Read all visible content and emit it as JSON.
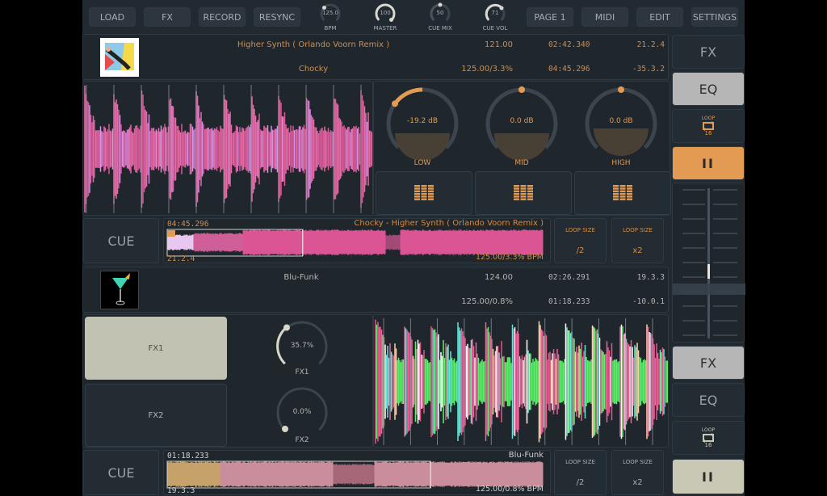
{
  "toolbar": {
    "buttons": [
      {
        "label": "LOAD"
      },
      {
        "label": "FX"
      },
      {
        "label": "RECORD"
      },
      {
        "label": "RESYNC"
      },
      {
        "label": "PAGE 1"
      },
      {
        "label": "MIDI"
      },
      {
        "label": "EDIT"
      },
      {
        "label": "SETTINGS"
      }
    ],
    "knobs": [
      {
        "label": "BPM",
        "value": "125.0"
      },
      {
        "label": "MASTER",
        "value": "100"
      },
      {
        "label": "CUE MIX",
        "value": "50"
      },
      {
        "label": "CUE VOL",
        "value": "71"
      }
    ]
  },
  "deck_a": {
    "title": "Higher Synth ( Orlando Voorn Remix )",
    "artist": "Chocky",
    "bpm_original": "121.00",
    "bpm_pitch": "125.00/3.3%",
    "elapsed": "02:42.340",
    "remaining": "04:45.296",
    "beat_pos": "21.2.4",
    "beat_remaining": "-35.3.2",
    "eq": [
      {
        "label": "LOW",
        "value": "-19.2 dB"
      },
      {
        "label": "MID",
        "value": "0.0 dB"
      },
      {
        "label": "HIGH",
        "value": "0.0 dB"
      }
    ],
    "cue_label": "CUE",
    "overview": {
      "time": "04:45.296",
      "track": "Chocky - Higher Synth ( Orlando Voorn Remix )",
      "beat": "21.2.4",
      "bpm": "125.00/3.3% BPM",
      "progress": 0.36
    },
    "loop_half": {
      "label": "LOOP SIZE",
      "value": "/2"
    },
    "loop_double": {
      "label": "LOOP SIZE",
      "value": "x2"
    },
    "side": {
      "fx": "FX",
      "eq": "EQ",
      "loop": "LOOP",
      "loop_size": "16",
      "pause": "II"
    }
  },
  "deck_b": {
    "title": "Blu-Funk",
    "artist": "",
    "bpm_original": "124.00",
    "bpm_pitch": "125.00/0.8%",
    "elapsed": "02:26.291",
    "remaining": "01:18.233",
    "beat_pos": "19.3.3",
    "beat_remaining": "-10.0.1",
    "fx_buttons": [
      {
        "label": "FX1",
        "active": true
      },
      {
        "label": "FX2",
        "active": false
      }
    ],
    "fx_knobs": [
      {
        "label": "FX1",
        "value": "35.7%"
      },
      {
        "label": "FX2",
        "value": "0.0%"
      }
    ],
    "cue_label": "CUE",
    "overview": {
      "time": "01:18.233",
      "track": "Blu-Funk",
      "beat": "19.3.3",
      "bpm": "125.00/0.8% BPM",
      "progress": 0.7
    },
    "loop_half": {
      "label": "LOOP SIZE",
      "value": "/2"
    },
    "loop_double": {
      "label": "LOOP SIZE",
      "value": "x2"
    },
    "side": {
      "fx": "FX",
      "eq": "EQ",
      "loop": "LOOP",
      "loop_size": "16",
      "pause": "II"
    }
  },
  "crossfader": {
    "position": 0.5
  },
  "colors": {
    "accent": "#e39a52",
    "waveform_pink": "#e86ba8",
    "active_button": "#c2c2b2",
    "background": "#222a31"
  }
}
